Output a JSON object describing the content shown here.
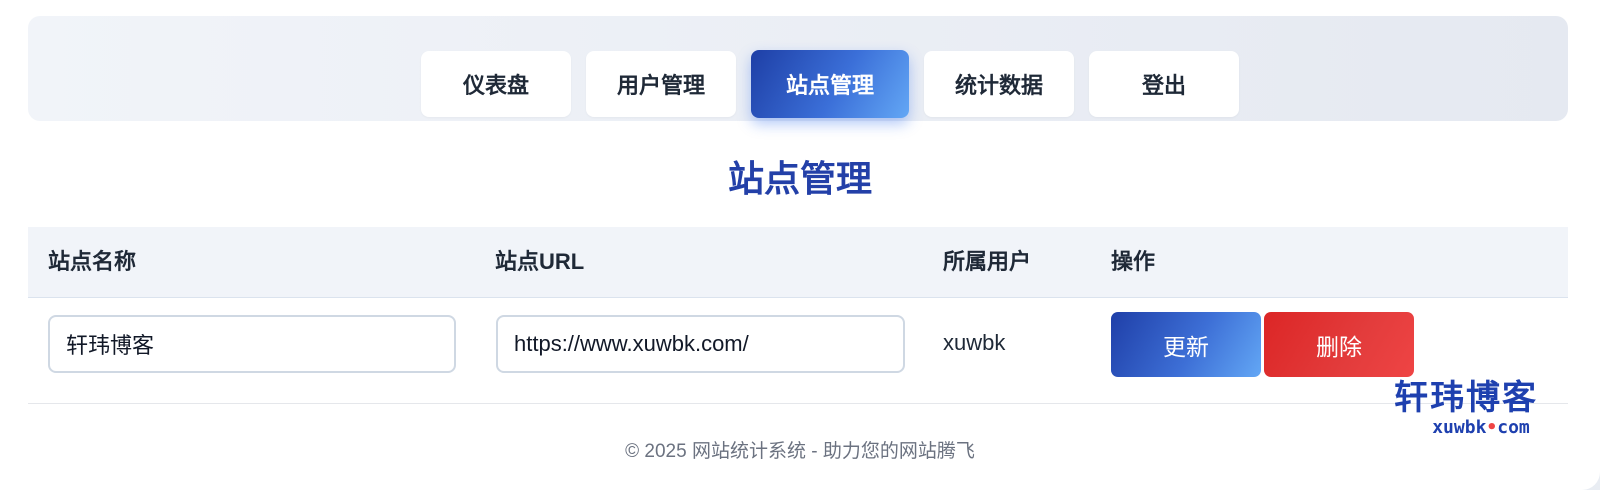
{
  "nav": {
    "items": [
      {
        "label": "仪表盘"
      },
      {
        "label": "用户管理"
      },
      {
        "label": "站点管理"
      },
      {
        "label": "统计数据"
      },
      {
        "label": "登出"
      }
    ],
    "active_index": 2
  },
  "page": {
    "title": "站点管理"
  },
  "table": {
    "headers": [
      "站点名称",
      "站点URL",
      "所属用户",
      "操作"
    ],
    "rows": [
      {
        "site_name": "轩玮博客",
        "site_url": "https://www.xuwbk.com/",
        "owner": "xuwbk",
        "update_label": "更新",
        "delete_label": "删除"
      }
    ]
  },
  "footer": {
    "text": "© 2025 网站统计系统 - 助力您的网站腾飞"
  },
  "watermark": {
    "title": "轩玮博客",
    "url_prefix": "xuwbk",
    "url_dot": "•",
    "url_suffix": "com"
  },
  "colors": {
    "accent": "#2340a8",
    "danger": "#dc2626",
    "footer_text": "#6b7280"
  }
}
